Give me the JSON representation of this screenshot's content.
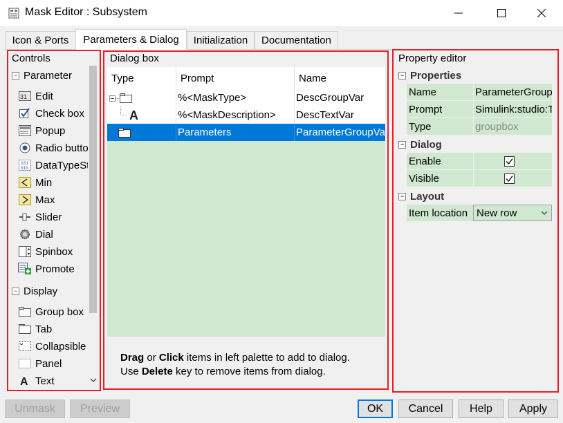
{
  "window": {
    "title": "Mask Editor : Subsystem"
  },
  "tabs": [
    {
      "label": "Icon & Ports"
    },
    {
      "label": "Parameters & Dialog"
    },
    {
      "label": "Initialization"
    },
    {
      "label": "Documentation"
    }
  ],
  "controls": {
    "title": "Controls",
    "groups": [
      {
        "label": "Parameter"
      },
      {
        "label": "Display"
      }
    ],
    "items": [
      {
        "label": "Edit",
        "icon": "edit-icon"
      },
      {
        "label": "Check box",
        "icon": "checkbox-icon"
      },
      {
        "label": "Popup",
        "icon": "popup-icon"
      },
      {
        "label": "Radio button",
        "icon": "radio-button-icon"
      },
      {
        "label": "DataTypeStr",
        "icon": "datatype-icon"
      },
      {
        "label": "Min",
        "icon": "min-icon"
      },
      {
        "label": "Max",
        "icon": "max-icon"
      },
      {
        "label": "Slider",
        "icon": "slider-icon"
      },
      {
        "label": "Dial",
        "icon": "dial-icon"
      },
      {
        "label": "Spinbox",
        "icon": "spinbox-icon"
      },
      {
        "label": "Promote",
        "icon": "promote-icon"
      },
      {
        "label": "Group box",
        "icon": "groupbox-icon"
      },
      {
        "label": "Tab",
        "icon": "tab-icon"
      },
      {
        "label": "Collapsible",
        "icon": "collapsible-icon"
      },
      {
        "label": "Panel",
        "icon": "panel-icon"
      },
      {
        "label": "Text",
        "icon": "text-icon"
      }
    ]
  },
  "dialog_box": {
    "title": "Dialog box",
    "columns": [
      "Type",
      "Prompt",
      "Name"
    ],
    "rows": [
      {
        "prompt": "%<MaskType>",
        "name": "DescGroupVar",
        "type_icon": "groupbox-icon"
      },
      {
        "prompt": "%<MaskDescription>",
        "name": "DescTextVar",
        "type_icon": "text-icon"
      },
      {
        "prompt": "Parameters",
        "name": "ParameterGroupVar",
        "type_icon": "groupbox-icon",
        "selected": true
      }
    ],
    "hint": {
      "drag": "Drag",
      "or": " or ",
      "click": "Click",
      "line1_rest": " items in left palette to add to dialog.",
      "use": "Use ",
      "delete": "Delete",
      "line2_rest": " key to remove items from dialog."
    }
  },
  "property_editor": {
    "title": "Property editor",
    "sections": {
      "properties": "Properties",
      "dialog": "Dialog",
      "layout": "Layout"
    },
    "properties": [
      {
        "name": "Name",
        "value": "ParameterGroupVar"
      },
      {
        "name": "Prompt",
        "value": "Simulink:studio:ToolBarParametersMenu"
      },
      {
        "name": "Type",
        "value": "groupbox"
      }
    ],
    "dialog": [
      {
        "name": "Enable",
        "checked": true
      },
      {
        "name": "Visible",
        "checked": true
      }
    ],
    "layout": [
      {
        "name": "Item location",
        "value": "New row"
      }
    ]
  },
  "buttons": {
    "unmask": "Unmask",
    "preview": "Preview",
    "ok": "OK",
    "cancel": "Cancel",
    "help": "Help",
    "apply": "Apply"
  },
  "colors": {
    "highlight_box": "#e81e25",
    "selection": "#0078d7",
    "grid_bg": "#cfe8cf"
  }
}
